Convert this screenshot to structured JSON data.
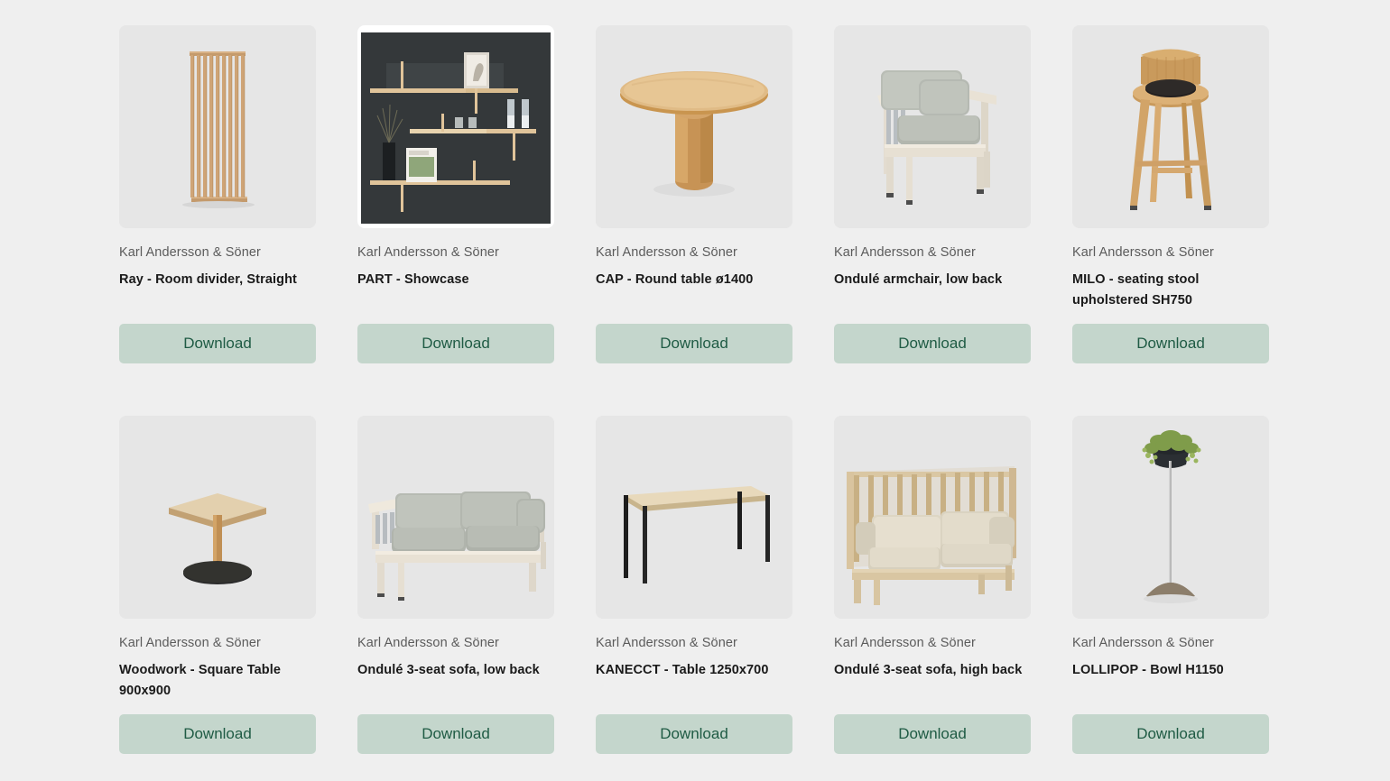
{
  "page": {
    "background_color": "#efefef",
    "card_background_color": "#e6e6e6",
    "button_background_color": "#c4d6cc",
    "button_text_color": "#1f5b44",
    "brand_text_color": "#5b5b5b",
    "title_text_color": "#1a1a1a"
  },
  "products": [
    {
      "brand": "Karl Andersson & Söner",
      "title": "Ray - Room divider, Straight",
      "download_label": "Download",
      "image": "room-divider-slatted-panel"
    },
    {
      "brand": "Karl Andersson & Söner",
      "title": "PART - Showcase",
      "download_label": "Download",
      "image": "wall-shelving-showcase-dark-wall"
    },
    {
      "brand": "Karl Andersson & Söner",
      "title": "CAP - Round table ø1400",
      "download_label": "Download",
      "image": "round-wooden-pedestal-table"
    },
    {
      "brand": "Karl Andersson & Söner",
      "title": "Ondulé armchair, low back",
      "download_label": "Download",
      "image": "wooden-armchair-grey-cushions"
    },
    {
      "brand": "Karl Andersson & Söner",
      "title": "MILO - seating stool upholstered SH750",
      "download_label": "Download",
      "image": "wooden-bar-stool-black-seat"
    },
    {
      "brand": "Karl Andersson & Söner",
      "title": "Woodwork - Square Table 900x900",
      "download_label": "Download",
      "image": "square-table-black-round-base"
    },
    {
      "brand": "Karl Andersson & Söner",
      "title": "Ondulé 3-seat sofa, low back",
      "download_label": "Download",
      "image": "grey-three-seat-sofa-low-back"
    },
    {
      "brand": "Karl Andersson & Söner",
      "title": "KANECCT - Table 1250x700",
      "download_label": "Download",
      "image": "rectangular-table-black-legs"
    },
    {
      "brand": "Karl Andersson & Söner",
      "title": "Ondulé 3-seat sofa, high back",
      "download_label": "Download",
      "image": "beige-three-seat-sofa-high-back"
    },
    {
      "brand": "Karl Andersson & Söner",
      "title": "LOLLIPOP - Bowl H1150",
      "download_label": "Download",
      "image": "plant-bowl-stand-on-pole"
    }
  ]
}
